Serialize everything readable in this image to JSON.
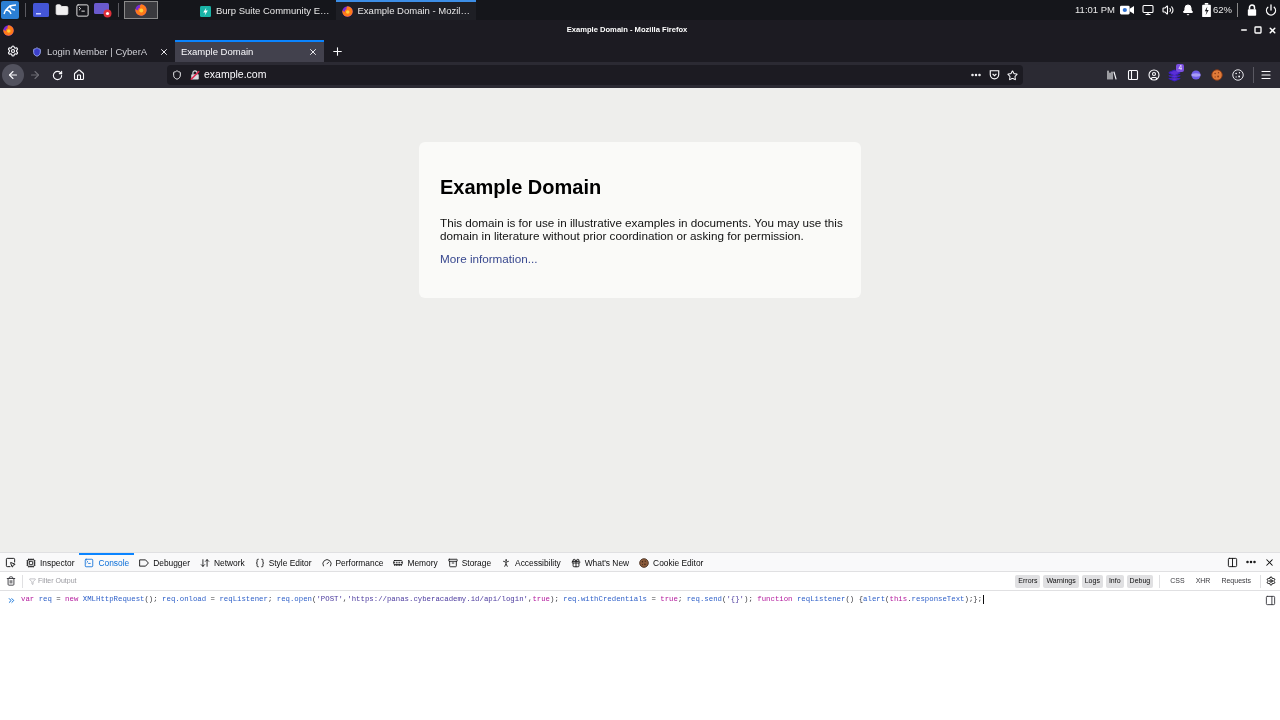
{
  "taskbar": {
    "tasks": [
      {
        "label": "Burp Suite Community E…",
        "selected": false
      },
      {
        "label": "Example Domain - Mozil…",
        "selected": true
      }
    ],
    "clock": "11:01 PM",
    "battery": "62%"
  },
  "window": {
    "title": "Example Domain - Mozilla Firefox"
  },
  "tabs": [
    {
      "label": "Login Member | CyberA",
      "selected": false
    },
    {
      "label": "Example Domain",
      "selected": true
    }
  ],
  "navigation": {
    "forward_disabled": true
  },
  "address_bar": {
    "value": "example.com"
  },
  "toolbar": {
    "extension_badge": "4"
  },
  "page": {
    "heading": "Example Domain",
    "paragraph": "This domain is for use in illustrative examples in documents. You may use this domain in literature without prior coordination or asking for permission.",
    "link": "More information..."
  },
  "devtools": {
    "tabs": [
      {
        "label": "Inspector",
        "selected": false
      },
      {
        "label": "Console",
        "selected": true
      },
      {
        "label": "Debugger",
        "selected": false
      },
      {
        "label": "Network",
        "selected": false
      },
      {
        "label": "Style Editor",
        "selected": false
      },
      {
        "label": "Performance",
        "selected": false
      },
      {
        "label": "Memory",
        "selected": false
      },
      {
        "label": "Storage",
        "selected": false
      },
      {
        "label": "Accessibility",
        "selected": false
      },
      {
        "label": "What's New",
        "selected": false
      },
      {
        "label": "Cookie Editor",
        "selected": false
      }
    ],
    "filter": {
      "placeholder": "Filter Output"
    },
    "log_filters": [
      {
        "label": "Errors",
        "on": true
      },
      {
        "label": "Warnings",
        "on": true
      },
      {
        "label": "Logs",
        "on": true
      },
      {
        "label": "Info",
        "on": true
      },
      {
        "label": "Debug",
        "on": true
      }
    ],
    "request_filters": [
      {
        "label": "CSS",
        "on": false
      },
      {
        "label": "XHR",
        "on": false
      },
      {
        "label": "Requests",
        "on": false
      }
    ],
    "console_input": [
      {
        "text": "var ",
        "kind": "keyword"
      },
      {
        "text": "req",
        "kind": "variable"
      },
      {
        "text": " = ",
        "kind": "plain"
      },
      {
        "text": "new ",
        "kind": "keyword"
      },
      {
        "text": "XMLHttpRequest",
        "kind": "variable"
      },
      {
        "text": "(); ",
        "kind": "plain"
      },
      {
        "text": "req.onload",
        "kind": "variable"
      },
      {
        "text": " = ",
        "kind": "plain"
      },
      {
        "text": "reqListener",
        "kind": "variable"
      },
      {
        "text": "; ",
        "kind": "plain"
      },
      {
        "text": "req.open",
        "kind": "variable"
      },
      {
        "text": "(",
        "kind": "plain"
      },
      {
        "text": "'POST'",
        "kind": "string"
      },
      {
        "text": ",",
        "kind": "plain"
      },
      {
        "text": "'https://panas.cyberacademy.id/api/login'",
        "kind": "string"
      },
      {
        "text": ",",
        "kind": "plain"
      },
      {
        "text": "true",
        "kind": "keyword"
      },
      {
        "text": "); ",
        "kind": "plain"
      },
      {
        "text": "req.withCredentials",
        "kind": "variable"
      },
      {
        "text": " = ",
        "kind": "plain"
      },
      {
        "text": "true",
        "kind": "keyword"
      },
      {
        "text": "; ",
        "kind": "plain"
      },
      {
        "text": "req.send",
        "kind": "variable"
      },
      {
        "text": "(",
        "kind": "plain"
      },
      {
        "text": "'{}'",
        "kind": "string"
      },
      {
        "text": "); ",
        "kind": "plain"
      },
      {
        "text": "function ",
        "kind": "keyword"
      },
      {
        "text": "reqListener",
        "kind": "variable"
      },
      {
        "text": "() {",
        "kind": "plain"
      },
      {
        "text": "alert",
        "kind": "variable"
      },
      {
        "text": "(",
        "kind": "plain"
      },
      {
        "text": "this",
        "kind": "keyword"
      },
      {
        "text": ".",
        "kind": "plain"
      },
      {
        "text": "responseText",
        "kind": "variable"
      },
      {
        "text": ");};",
        "kind": "plain"
      }
    ]
  }
}
